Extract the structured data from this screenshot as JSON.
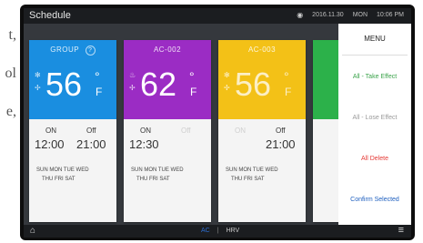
{
  "left_text": [
    "t,",
    "ol",
    "e,"
  ],
  "app": {
    "title": "Schedule"
  },
  "status": {
    "wifi_icon": "wifi-icon",
    "date": "2016.11.30",
    "day": "MON",
    "time": "10:06 PM"
  },
  "cards": [
    {
      "name": "GROUP",
      "help": "?",
      "temp": "56",
      "deg": "°",
      "unit": "F",
      "color": "#1a8ee0",
      "on_label": "ON",
      "on_time": "12:00",
      "off_label": "Off",
      "off_time": "21:00",
      "days_row1": "SUN  MON  TUE  WED",
      "days_row2": "THU  FRI  SAT"
    },
    {
      "name": "AC-002",
      "temp": "62",
      "deg": "°",
      "unit": "F",
      "color": "#9b2cc4",
      "on_label": "ON",
      "on_time": "12:30",
      "off_label": "Off",
      "off_time": "",
      "days_row1": "SUN  MON  TUE  WED",
      "days_row2": "THU  FRI  SAT"
    },
    {
      "name": "AC-003",
      "temp": "56",
      "deg": "°",
      "unit": "F",
      "color": "#f3c117",
      "on_label": "ON",
      "on_time": "",
      "off_label": "Off",
      "off_time": "21:00",
      "days_row1": "SUN  MON  TUE  WED",
      "days_row2": "THU  FRI  SAT"
    },
    {
      "color": "#2cb14a"
    }
  ],
  "menu": {
    "title": "MENU",
    "items": [
      {
        "label": "All - Take Effect",
        "color": "#3aa34a"
      },
      {
        "label": "All - Lose Effect",
        "color": "#9a9a9a"
      },
      {
        "label": "All Delete",
        "color": "#e53935"
      },
      {
        "label": "Confirm Selected",
        "color": "#1e5fbf"
      }
    ]
  },
  "bottom": {
    "home_icon": "home-icon",
    "tab1": "AC",
    "tab2": "HRV",
    "menu_icon": "menu-icon"
  }
}
